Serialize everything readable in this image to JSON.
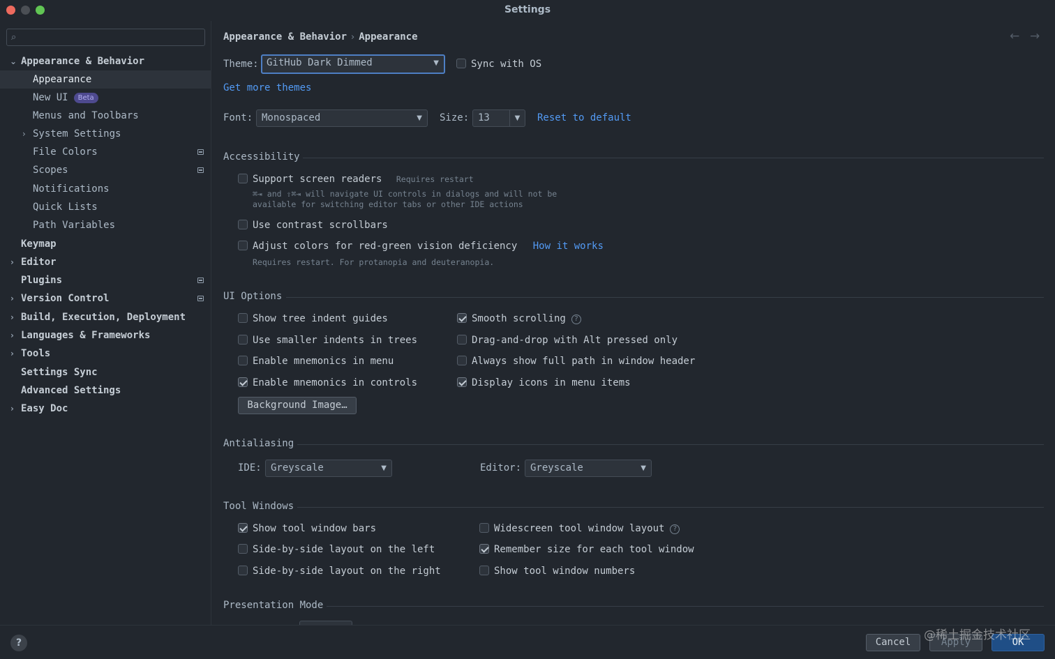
{
  "window": {
    "title": "Settings"
  },
  "sidebar": {
    "search_placeholder": "",
    "items": [
      {
        "label": "Appearance & Behavior",
        "expander": "⌄"
      },
      {
        "label": "Appearance"
      },
      {
        "label": "New UI",
        "badge": "Beta"
      },
      {
        "label": "Menus and Toolbars"
      },
      {
        "label": "System Settings",
        "expander": "›"
      },
      {
        "label": "File Colors"
      },
      {
        "label": "Scopes"
      },
      {
        "label": "Notifications"
      },
      {
        "label": "Quick Lists"
      },
      {
        "label": "Path Variables"
      },
      {
        "label": "Keymap"
      },
      {
        "label": "Editor",
        "expander": "›"
      },
      {
        "label": "Plugins"
      },
      {
        "label": "Version Control",
        "expander": "›"
      },
      {
        "label": "Build, Execution, Deployment",
        "expander": "›"
      },
      {
        "label": "Languages & Frameworks",
        "expander": "›"
      },
      {
        "label": "Tools",
        "expander": "›"
      },
      {
        "label": "Settings Sync"
      },
      {
        "label": "Advanced Settings"
      },
      {
        "label": "Easy Doc",
        "expander": "›"
      }
    ],
    "help_label": "?"
  },
  "main": {
    "breadcrumb": {
      "parent": "Appearance & Behavior",
      "separator": "›",
      "current": "Appearance"
    },
    "nav": {
      "back": "←",
      "forward": "→"
    },
    "theme": {
      "label": "Theme:",
      "value": "GitHub Dark Dimmed",
      "sync_label": "Sync with OS",
      "sync_checked": false,
      "get_more": "Get more themes"
    },
    "font": {
      "label": "Font:",
      "value": "Monospaced",
      "size_label": "Size:",
      "size_value": "13",
      "reset": "Reset to default"
    },
    "accessibility": {
      "title": "Accessibility",
      "screen_readers": {
        "label": "Support screen readers",
        "note": "Requires restart",
        "hint1": "⌘⇥ and ⇧⌘⇥ will navigate UI controls in dialogs and will not be",
        "hint2": "available for switching editor tabs or other IDE actions",
        "checked": false
      },
      "contrast_scrollbars": {
        "label": "Use contrast scrollbars",
        "checked": false
      },
      "red_green": {
        "label": "Adjust colors for red-green vision deficiency",
        "link": "How it works",
        "hint": "Requires restart. For protanopia and deuteranopia.",
        "checked": false
      }
    },
    "ui_options": {
      "title": "UI Options",
      "left": [
        {
          "label": "Show tree indent guides",
          "checked": false
        },
        {
          "label": "Use smaller indents in trees",
          "checked": false
        },
        {
          "label": "Enable mnemonics in menu",
          "checked": false
        },
        {
          "label": "Enable mnemonics in controls",
          "checked": true
        }
      ],
      "right": [
        {
          "label": "Smooth scrolling",
          "checked": true,
          "help": "?"
        },
        {
          "label": "Drag-and-drop with Alt pressed only",
          "checked": false
        },
        {
          "label": "Always show full path in window header",
          "checked": false
        },
        {
          "label": "Display icons in menu items",
          "checked": true
        }
      ],
      "background_image_button": "Background Image…"
    },
    "antialiasing": {
      "title": "Antialiasing",
      "ide_label": "IDE:",
      "ide_value": "Greyscale",
      "editor_label": "Editor:",
      "editor_value": "Greyscale"
    },
    "tool_windows": {
      "title": "Tool Windows",
      "left": [
        {
          "label": "Show tool window bars",
          "checked": true
        },
        {
          "label": "Side-by-side layout on the left",
          "checked": false
        },
        {
          "label": "Side-by-side layout on the right",
          "checked": false
        }
      ],
      "right": [
        {
          "label": "Widescreen tool window layout",
          "checked": false,
          "help": "?"
        },
        {
          "label": "Remember size for each tool window",
          "checked": true
        },
        {
          "label": "Show tool window numbers",
          "checked": false
        }
      ]
    },
    "presentation_mode": {
      "title": "Presentation Mode"
    }
  },
  "footer": {
    "cancel": "Cancel",
    "apply": "Apply",
    "ok": "OK"
  },
  "watermark": "@稀土掘金技术社区"
}
